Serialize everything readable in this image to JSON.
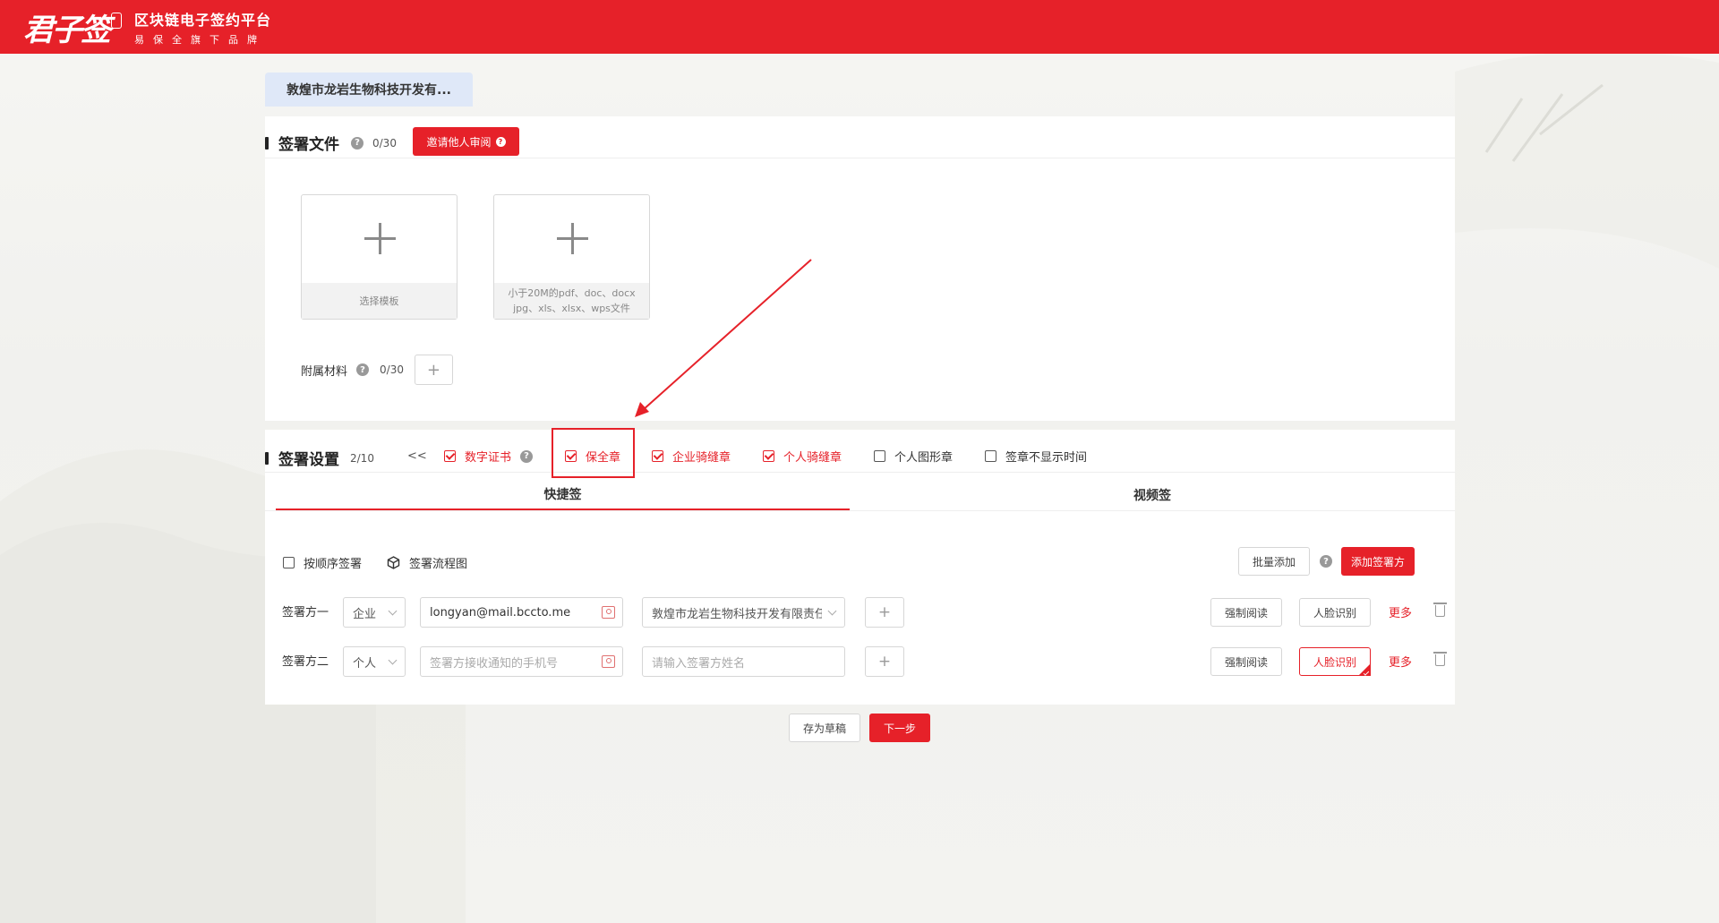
{
  "header": {
    "logo_mark": "君子签",
    "title": "区块链电子签约平台",
    "subtitle": "易保全旗下品牌",
    "color": "#e62129"
  },
  "doc_tab": {
    "label": "敦煌市龙岩生物科技开发有..."
  },
  "files": {
    "title": "签署文件",
    "count": "0/30",
    "invite_button": "邀请他人审阅",
    "template_card": {
      "label": "选择模板"
    },
    "upload_card": {
      "line1": "小于20M的pdf、doc、docx",
      "line2": "jpg、xls、xlsx、wps文件"
    },
    "attachments": {
      "label": "附属材料",
      "count": "0/30",
      "add": "+"
    }
  },
  "settings": {
    "title": "签署设置",
    "count": "2/10",
    "collapse": "<<",
    "options": [
      {
        "label": "数字证书",
        "checked": true
      },
      {
        "label": "保全章",
        "checked": true
      },
      {
        "label": "企业骑缝章",
        "checked": true
      },
      {
        "label": "个人骑缝章",
        "checked": true
      },
      {
        "label": "个人图形章",
        "checked": false
      },
      {
        "label": "签章不显示时间",
        "checked": false
      }
    ],
    "tabs": [
      {
        "label": "快捷签",
        "active": true
      },
      {
        "label": "视频签",
        "active": false
      }
    ],
    "sequential": {
      "label": "按顺序签署",
      "checked": false
    },
    "flowchart": "签署流程图",
    "batch_add": "批量添加",
    "add_signer": "添加签署方",
    "signers": [
      {
        "label": "签署方一",
        "type": "企业",
        "contact_value": "longyan@mail.bccto.me",
        "contact_placeholder": "",
        "name_value": "敦煌市龙岩生物科技开发有限责任",
        "name_placeholder": "",
        "force_read": "强制阅读",
        "face": "人脸识别",
        "face_on": false,
        "more": "更多"
      },
      {
        "label": "签署方二",
        "type": "个人",
        "contact_value": "",
        "contact_placeholder": "签署方接收通知的手机号",
        "name_value": "",
        "name_placeholder": "请输入签署方姓名",
        "force_read": "强制阅读",
        "face": "人脸识别",
        "face_on": true,
        "more": "更多"
      }
    ]
  },
  "footer": {
    "save_draft": "存为草稿",
    "next": "下一步"
  }
}
